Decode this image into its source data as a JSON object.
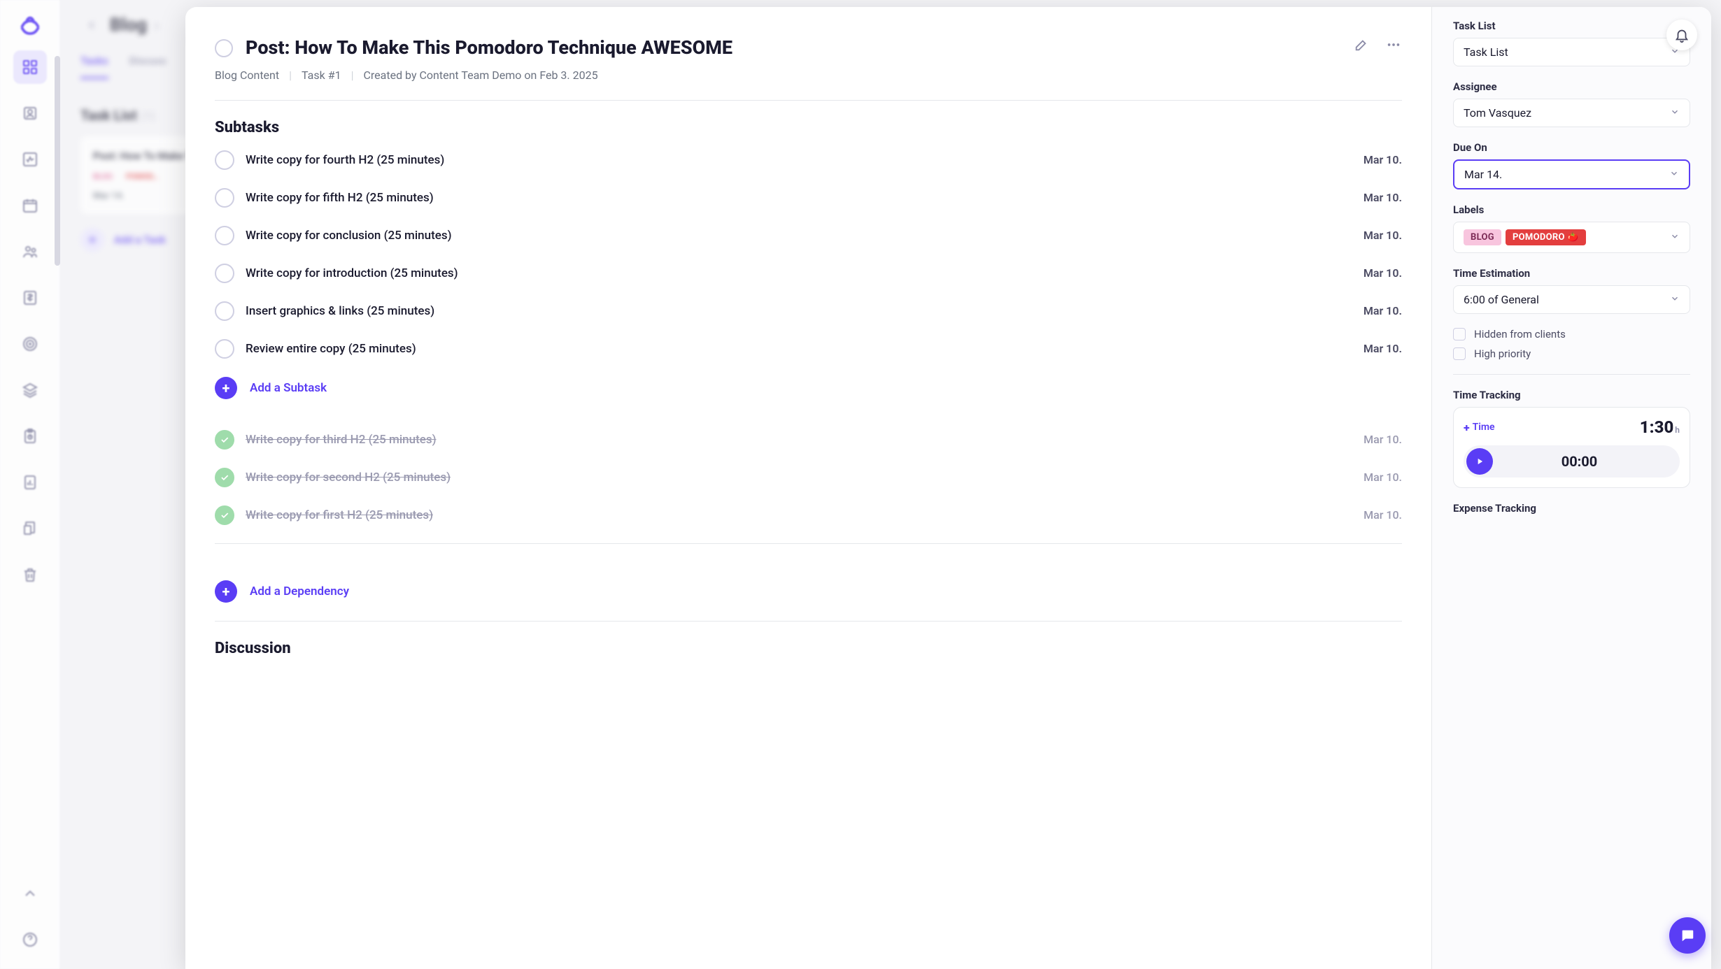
{
  "sidebar": {
    "items": [
      "dashboard",
      "profile",
      "activity",
      "calendar",
      "team",
      "billing",
      "target",
      "layers",
      "clipboard",
      "reports",
      "docs",
      "trash"
    ]
  },
  "background": {
    "breadcrumb_title": "Blog",
    "tabs": [
      {
        "label": "Tasks",
        "active": true
      },
      {
        "label": "Discuss",
        "active": false
      }
    ],
    "list_title": "Task List",
    "list_count": "(1)",
    "card": {
      "title": "Post: How To Make This Pomodoro Technique AWESOME",
      "tag1": "BLOG",
      "tag_sep": "·",
      "tag2": "POMOD…",
      "due": "Mar 14."
    },
    "add_label": "Add a Task"
  },
  "task": {
    "title": "Post: How To Make This Pomodoro Technique AWESOME",
    "project": "Blog Content",
    "task_number": "Task #1",
    "created_by": "Created by Content Team Demo on Feb 3. 2025",
    "subtasks_heading": "Subtasks",
    "subtasks": [
      {
        "label": "Write copy for fourth H2 (25 minutes)",
        "date": "Mar 10.",
        "done": false
      },
      {
        "label": "Write copy for fifth H2 (25 minutes)",
        "date": "Mar 10.",
        "done": false
      },
      {
        "label": "Write copy for conclusion (25 minutes)",
        "date": "Mar 10.",
        "done": false
      },
      {
        "label": "Write copy for introduction (25 minutes)",
        "date": "Mar 10.",
        "done": false
      },
      {
        "label": "Insert graphics & links (25 minutes)",
        "date": "Mar 10.",
        "done": false
      },
      {
        "label": "Review entire copy (25 minutes)",
        "date": "Mar 10.",
        "done": false
      }
    ],
    "add_subtask_label": "Add a Subtask",
    "completed_subtasks": [
      {
        "label": "Write copy for third H2 (25 minutes)",
        "date": "Mar 10."
      },
      {
        "label": "Write copy for second H2 (25 minutes)",
        "date": "Mar 10."
      },
      {
        "label": "Write copy for first H2 (25 minutes)",
        "date": "Mar 10."
      }
    ],
    "add_dependency_label": "Add a Dependency",
    "discussion_heading": "Discussion"
  },
  "side": {
    "task_list": {
      "label": "Task List",
      "value": "Task List"
    },
    "assignee": {
      "label": "Assignee",
      "value": "Tom Vasquez"
    },
    "due_on": {
      "label": "Due On",
      "value": "Mar 14."
    },
    "labels": {
      "label": "Labels",
      "tags": [
        {
          "text": "BLOG",
          "cls": "blog"
        },
        {
          "text": "POMODORO 🍅",
          "cls": "pomo"
        }
      ]
    },
    "time_estimation": {
      "label": "Time Estimation",
      "value": "6:00 of General"
    },
    "hidden_clients": "Hidden from clients",
    "high_priority": "High priority",
    "time_tracking": {
      "label": "Time Tracking",
      "add_time_label": "Time",
      "total": "1:30",
      "unit": "h",
      "timer": "00:00"
    },
    "expense_tracking": {
      "label": "Expense Tracking"
    }
  }
}
